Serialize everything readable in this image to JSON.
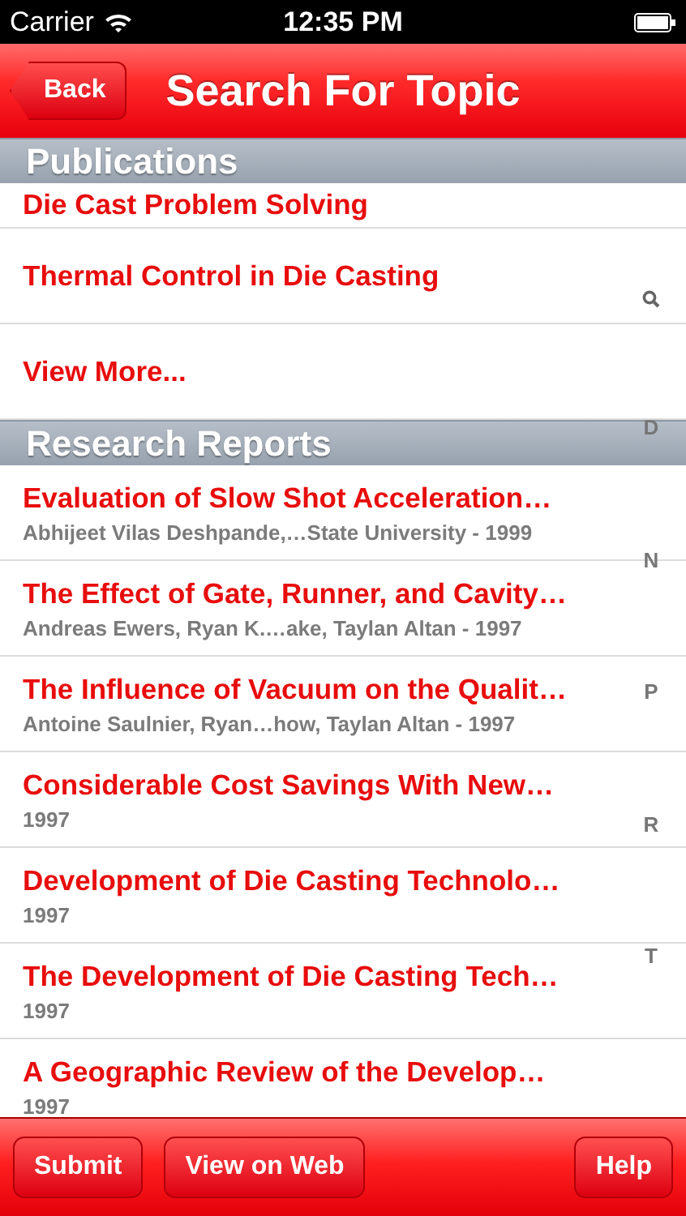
{
  "status_bar": {
    "carrier": "Carrier",
    "time": "12:35 PM"
  },
  "nav_bar": {
    "back": "Back",
    "title": "Search For Topic"
  },
  "sections": [
    {
      "title": "Publications",
      "rows": [
        {
          "title": "Die Cast Problem Solving"
        },
        {
          "title": "Thermal Control in Die Casting"
        },
        {
          "title": "View More..."
        }
      ]
    },
    {
      "title": "Research Reports",
      "rows": [
        {
          "title": "Evaluation of Slow Shot Acceleration…",
          "subtitle": "Abhijeet Vilas Deshpande,…State University - 1999"
        },
        {
          "title": "The Effect of Gate, Runner, and Cavity…",
          "subtitle": "Andreas Ewers, Ryan K.…ake, Taylan Altan - 1997"
        },
        {
          "title": "The Influence of Vacuum on the Qualit…",
          "subtitle": "Antoine Saulnier, Ryan…how, Taylan Altan - 1997"
        },
        {
          "title": "Considerable Cost Savings With New…",
          "subtitle": "1997"
        },
        {
          "title": "Development of Die Casting Technolo…",
          "subtitle": "1997"
        },
        {
          "title": "The Development of Die Casting Tech…",
          "subtitle": "1997"
        },
        {
          "title": "A Geographic Review of the Develop…",
          "subtitle": "1997"
        }
      ]
    }
  ],
  "section_index": [
    {
      "kind": "search"
    },
    {
      "kind": "letter",
      "label": "D"
    },
    {
      "kind": "letter",
      "label": "N"
    },
    {
      "kind": "letter",
      "label": "P"
    },
    {
      "kind": "letter",
      "label": "R"
    },
    {
      "kind": "letter",
      "label": "T"
    }
  ],
  "toolbar": {
    "buttons": [
      "Submit",
      "View on Web",
      "Help"
    ]
  }
}
